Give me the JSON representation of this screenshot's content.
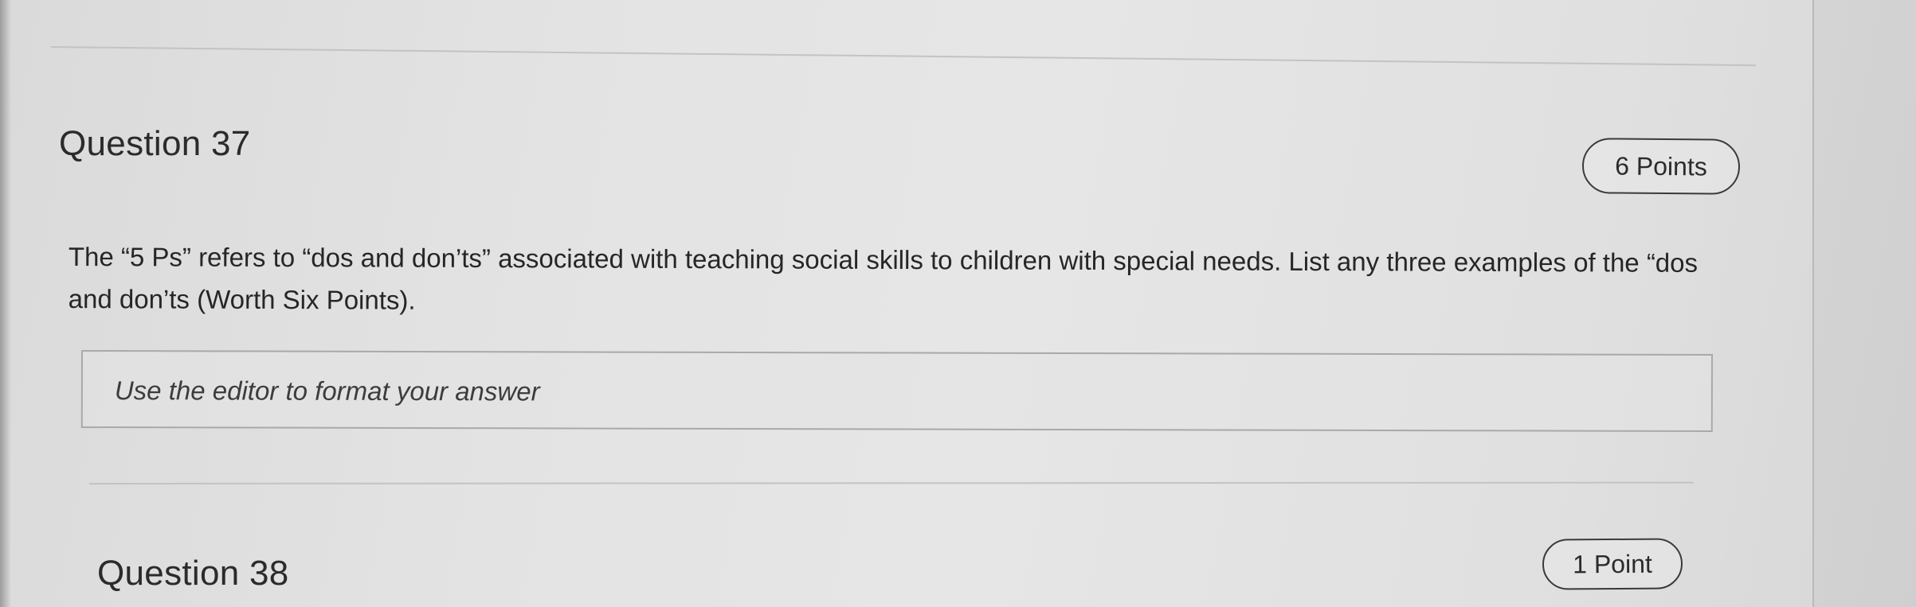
{
  "questions": [
    {
      "title": "Question 37",
      "points": "6 Points",
      "prompt": "The “5 Ps” refers to “dos and don’ts” associated with teaching social skills to children with special needs. List any three examples of the “dos and don’ts (Worth Six Points).",
      "answer": {
        "placeholder": "Use the editor to format your answer",
        "value": ""
      }
    },
    {
      "title": "Question 38",
      "points": "1 Point"
    }
  ]
}
